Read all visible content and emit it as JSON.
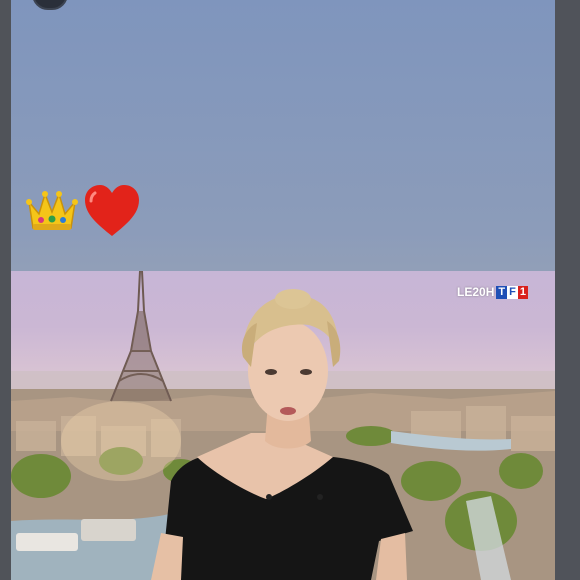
{
  "story": {
    "background_colors": [
      "#7f95bd",
      "#8e9cb4"
    ],
    "header": {
      "avatar": "profile-avatar",
      "meta_icon": "more-icon"
    },
    "stickers": [
      {
        "name": "crown-emoji",
        "glyph": "👑"
      },
      {
        "name": "red-heart-emoji",
        "glyph": "❤️"
      }
    ]
  },
  "tv_screenshot": {
    "channel_logo": {
      "show": "LE20H",
      "channel_letters": [
        "T",
        "F",
        "1"
      ]
    },
    "colors": {
      "tf1_blue": "#1f4fb6",
      "tf1_red": "#d9201c",
      "dress": "#151515",
      "hair": "#d8bf8e"
    }
  }
}
